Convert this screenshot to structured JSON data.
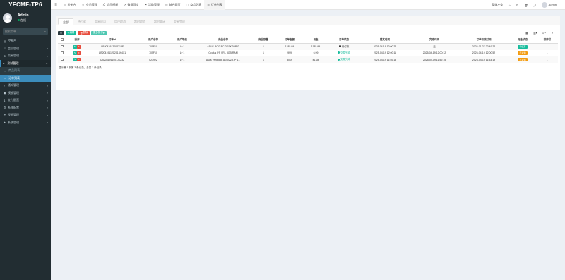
{
  "app": {
    "logo": "YFCMF-TP6"
  },
  "user": {
    "name": "Admin",
    "status": "在线"
  },
  "sidebar": {
    "search_placeholder": "搜索菜单",
    "items": [
      {
        "label": "控制台",
        "icon": "dashboard-icon"
      },
      {
        "label": "会员管理",
        "icon": "user-icon"
      },
      {
        "label": "交易管理",
        "icon": "cart-icon"
      },
      {
        "label": "测试管理",
        "icon": "folder-icon",
        "open": true
      },
      {
        "label": "商品列表",
        "icon": "circle-icon",
        "sub": true
      },
      {
        "label": "订单列表",
        "icon": "circle-icon",
        "active": true
      },
      {
        "label": "通知管理",
        "icon": "bell-icon"
      },
      {
        "label": "模板管理",
        "icon": "template-icon"
      },
      {
        "label": "支付配置",
        "icon": "pay-icon"
      },
      {
        "label": "系统配置",
        "icon": "gear-icon"
      },
      {
        "label": "权限管理",
        "icon": "lock-icon"
      },
      {
        "label": "系统管理",
        "icon": "cog-icon"
      }
    ]
  },
  "topbar": {
    "items": [
      {
        "label": "控制台",
        "icon": "monitor-icon"
      },
      {
        "label": "会员管理",
        "icon": "user-icon"
      },
      {
        "label": "会员模板",
        "icon": "print-icon"
      },
      {
        "label": "数据同步",
        "icon": "sync-icon"
      },
      {
        "label": "活动管理",
        "icon": "flag-icon"
      },
      {
        "label": "前台网页",
        "icon": "globe-icon"
      },
      {
        "label": "商品列表",
        "icon": "box-icon"
      },
      {
        "label": "订单列表",
        "icon": "list-icon",
        "active": true
      }
    ],
    "right": [
      "简体中文",
      "清除缓存",
      "前台",
      "全屏",
      "Admin"
    ]
  },
  "tabs": [
    "全部",
    "待付款",
    "交易成功",
    "用户取消",
    "超时取消",
    "超时关闭",
    "交易完成"
  ],
  "toolbar": {
    "edit": "编辑",
    "delete": "删除",
    "more": "更多操作"
  },
  "table": {
    "headers": [
      "",
      "操作",
      "订单id",
      "用户名称",
      "用户等级",
      "商品名称",
      "商品数量",
      "订单金额",
      "佣金",
      "订单状态",
      "提交时间",
      "完成时间",
      "订单有效时间",
      "佣金状态",
      "排序号"
    ],
    "rows": [
      {
        "id": "UB2041912002213E",
        "user": "705F10",
        "level": "Lv 1",
        "product": "ASUS ROG PC DESKTOP G",
        "qty": "1",
        "amount": "1185.99",
        "commission": "1185.99",
        "status": "待付款",
        "status_color": "#333",
        "submit": "2025-04-19 12:00:22",
        "complete": "无",
        "valid": "2025-01-27 22:49:22",
        "cstatus": "待结算",
        "cstatus_class": "badge-teal",
        "sort": "-"
      },
      {
        "id": "UB2041911212013X4X1",
        "user": "705F10",
        "level": "Lv 1",
        "product": "Oculus PS VR - 8GB RAM",
        "qty": "1",
        "amount": "999",
        "commission": "6.99",
        "status": "交易完成",
        "status_color": "#18bc9c",
        "submit": "2025-04-19 12:00:11",
        "complete": "2025-04-19 12:00:12",
        "valid": "2025-04-19 12:00:52",
        "cstatus": "已返佣",
        "cstatus_class": "badge-orange",
        "sort": "-"
      },
      {
        "id": "UB2041911501JK232",
        "user": "523922",
        "level": "Lv 1",
        "product": "Asus Vivobook A1402ZA IP 1...",
        "qty": "1",
        "amount": "8019",
        "commission": "$1.28",
        "status": "交易完成",
        "status_color": "#18bc9c",
        "submit": "2025-04-19 11:50:13",
        "complete": "2025-04-19 11:50:15",
        "valid": "2025-04-19 11:53:19",
        "cstatus": "已返佣",
        "cstatus_class": "badge-orange",
        "sort": "-"
      }
    ]
  },
  "pagination_info": "显示第 1 到第 3 条记录，总共 3 条记录"
}
